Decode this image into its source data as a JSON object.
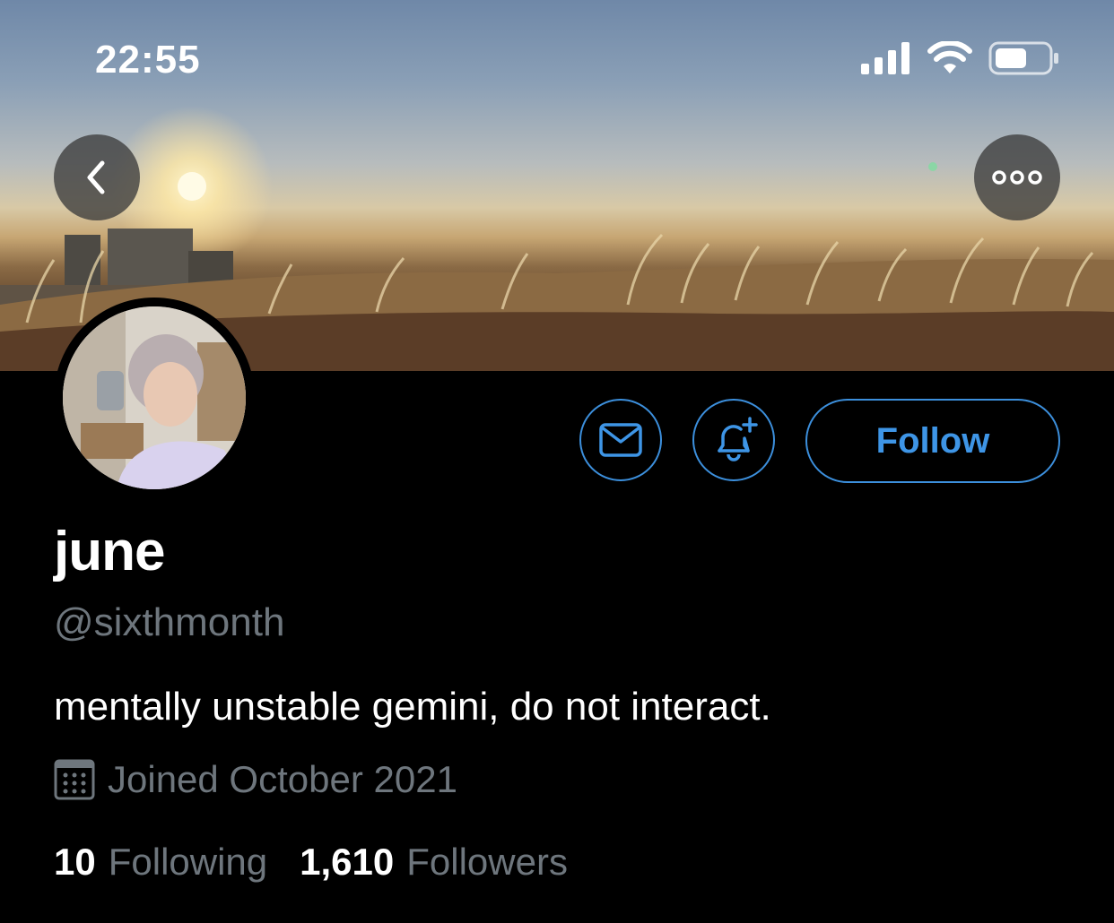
{
  "status_bar": {
    "time": "22:55",
    "icons": [
      "cellular-signal-icon",
      "wifi-icon",
      "battery-icon"
    ]
  },
  "header": {
    "back_icon": "chevron-left-icon",
    "more_icon": "more-horizontal-icon"
  },
  "actions": {
    "message_icon": "mail-icon",
    "notify_icon": "bell-plus-icon",
    "follow_label": "Follow"
  },
  "profile": {
    "display_name": "june",
    "handle": "@sixthmonth",
    "bio": "mentally unstable gemini, do not interact.",
    "joined": "Joined October 2021",
    "following_count": "10",
    "following_label": "Following",
    "followers_count": "1,610",
    "followers_label": "Followers"
  },
  "colors": {
    "accent": "#3e95e6",
    "background": "#000000",
    "secondary_text": "#6e767d"
  }
}
